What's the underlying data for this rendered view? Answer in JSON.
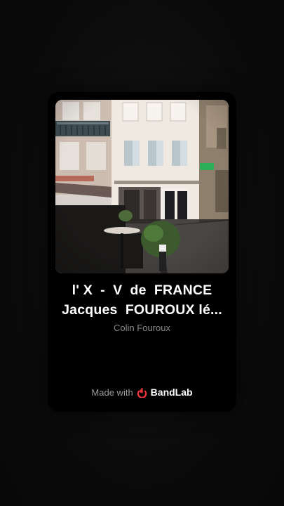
{
  "track": {
    "title_line1": "l' X  -  V  de  FRANCE",
    "title_line2": "Jacques  FOUROUX lé...",
    "artist": "Colin Fouroux"
  },
  "footer": {
    "made_with": "Made with",
    "brand": "BandLab"
  },
  "colors": {
    "brand_red": "#f0353f",
    "background": "#0b0b0b"
  },
  "icons": {
    "brand_logo": "bandlab-logo-icon"
  }
}
